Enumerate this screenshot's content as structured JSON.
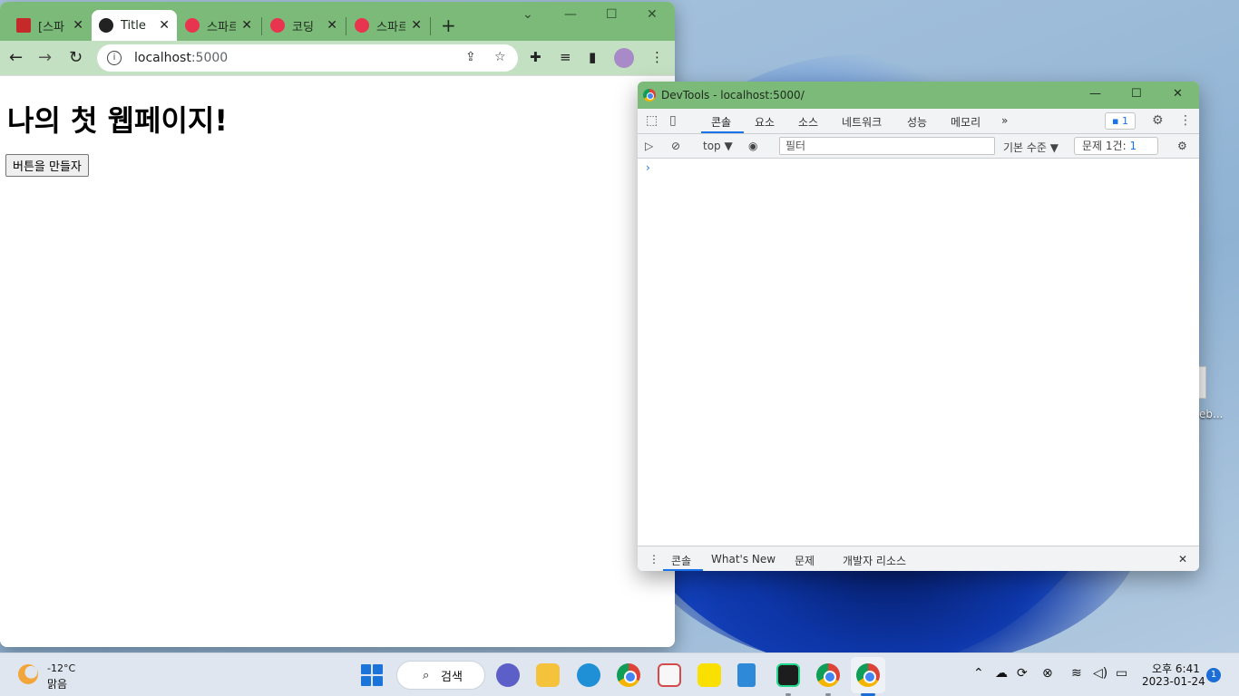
{
  "browser": {
    "tabs": [
      {
        "label": "[스파",
        "icon": "book-icon",
        "active": false
      },
      {
        "label": "Title",
        "icon": "globe-icon",
        "active": true
      },
      {
        "label": "스파르",
        "icon": "sparta-icon",
        "active": false
      },
      {
        "label": "코딩",
        "icon": "sparta-icon",
        "active": false
      },
      {
        "label": "스파르",
        "icon": "sparta-icon",
        "active": false
      }
    ],
    "close_glyph": "✕",
    "new_tab_glyph": "+",
    "url_host": "localhost",
    "url_port": ":5000",
    "colors": {
      "frame": "#7cba79",
      "toolbar": "#c4e0c2",
      "profile": "#a98ac9"
    }
  },
  "page": {
    "heading": "나의 첫 웹페이지!",
    "button_label": "버튼을 만들자"
  },
  "devtools": {
    "title": "DevTools - localhost:5000/",
    "tabs": [
      "콘솔",
      "요소",
      "소스",
      "네트워크",
      "성능",
      "메모리"
    ],
    "more_glyph": "»",
    "issues_badge": "1",
    "context": "top",
    "filter_placeholder": "필터",
    "level": "기본 수준",
    "issues_label": "문제 1건:",
    "issues_count": "1",
    "prompt": "›",
    "drawer_tabs": [
      "콘솔",
      "What's New",
      "문제",
      "개발자 리소스"
    ]
  },
  "desktop": {
    "icon_label": "eb..."
  },
  "taskbar": {
    "temperature": "-12°C",
    "weather": "맑음",
    "search_label": "검색",
    "time": "오후 6:41",
    "date": "2023-01-24",
    "notification_count": "1"
  }
}
